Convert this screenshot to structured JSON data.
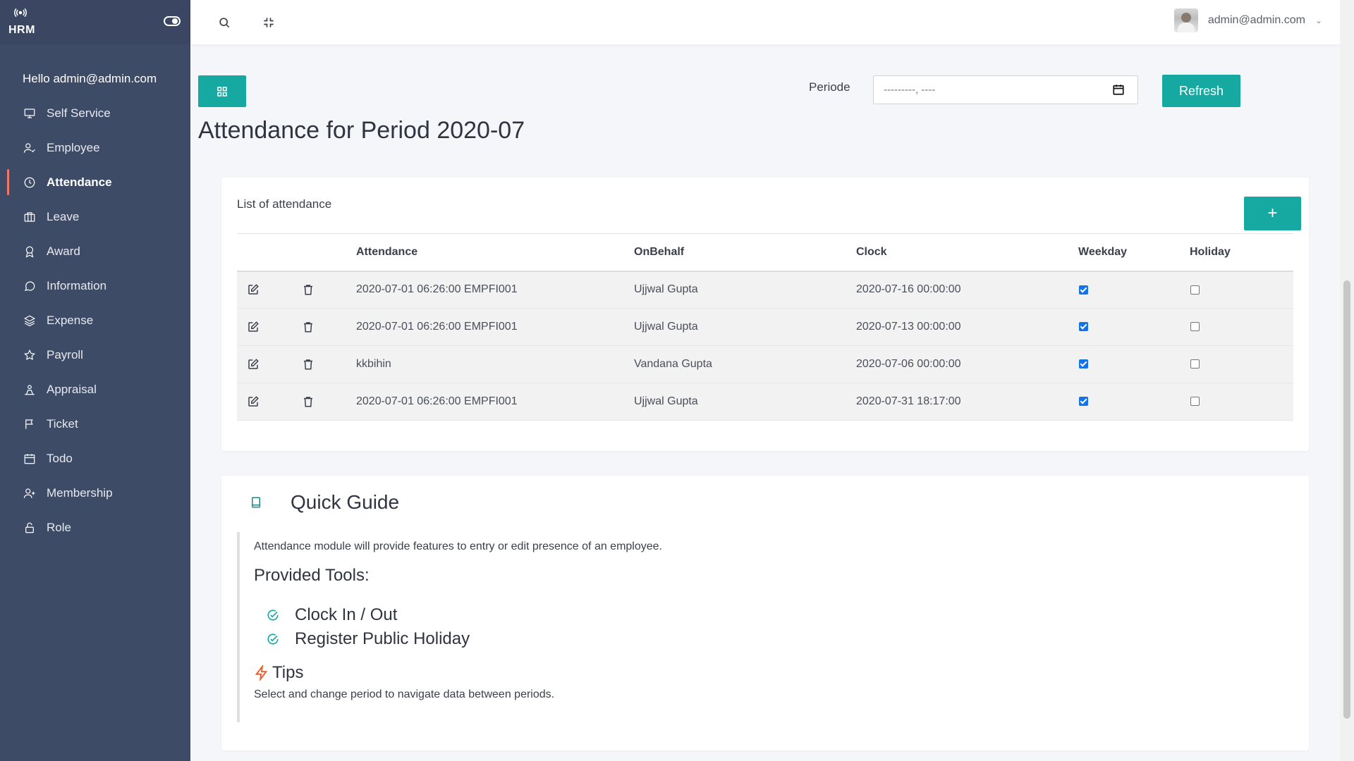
{
  "brand": {
    "name": "HRM",
    "logo_icon": "broadcast-icon",
    "toggle_icon": "toggle-icon"
  },
  "sidebar": {
    "greeting": "Hello admin@admin.com",
    "items": [
      {
        "label": "Self Service",
        "icon": "monitor-icon",
        "active": false
      },
      {
        "label": "Employee",
        "icon": "user-check-icon",
        "active": false
      },
      {
        "label": "Attendance",
        "icon": "clock-icon",
        "active": true
      },
      {
        "label": "Leave",
        "icon": "briefcase-icon",
        "active": false
      },
      {
        "label": "Award",
        "icon": "award-icon",
        "active": false
      },
      {
        "label": "Information",
        "icon": "chat-icon",
        "active": false
      },
      {
        "label": "Expense",
        "icon": "layers-icon",
        "active": false
      },
      {
        "label": "Payroll",
        "icon": "star-icon",
        "active": false
      },
      {
        "label": "Appraisal",
        "icon": "appraisal-icon",
        "active": false
      },
      {
        "label": "Ticket",
        "icon": "flag-icon",
        "active": false
      },
      {
        "label": "Todo",
        "icon": "calendar-icon",
        "active": false
      },
      {
        "label": "Membership",
        "icon": "user-plus-icon",
        "active": false
      },
      {
        "label": "Role",
        "icon": "lock-icon",
        "active": false
      }
    ]
  },
  "topbar": {
    "search_icon": "search-icon",
    "fullscreen_icon": "minimize-icon",
    "user_email": "admin@admin.com"
  },
  "toolbar": {
    "periode_label": "Periode",
    "periode_placeholder": "---------, ----",
    "refresh_label": "Refresh"
  },
  "page": {
    "title": "Attendance for Period 2020-07"
  },
  "list": {
    "title": "List of attendance",
    "add_label": "+",
    "columns": [
      "Attendance",
      "OnBehalf",
      "Clock",
      "Weekday",
      "Holiday"
    ],
    "rows": [
      {
        "attendance": "2020-07-01 06:26:00 EMPFI001",
        "onbehalf": "Ujjwal Gupta",
        "clock": "2020-07-16 00:00:00",
        "weekday": true,
        "holiday": false
      },
      {
        "attendance": "2020-07-01 06:26:00 EMPFI001",
        "onbehalf": "Ujjwal Gupta",
        "clock": "2020-07-13 00:00:00",
        "weekday": true,
        "holiday": false
      },
      {
        "attendance": "kkbihin",
        "onbehalf": "Vandana Gupta",
        "clock": "2020-07-06 00:00:00",
        "weekday": true,
        "holiday": false
      },
      {
        "attendance": "2020-07-01 06:26:00 EMPFI001",
        "onbehalf": "Ujjwal Gupta",
        "clock": "2020-07-31 18:17:00",
        "weekday": true,
        "holiday": false
      }
    ]
  },
  "guide": {
    "title": "Quick Guide",
    "description": "Attendance module will provide features to entry or edit presence of an employee.",
    "tools_heading": "Provided Tools:",
    "tools": [
      "Clock In / Out",
      "Register Public Holiday"
    ],
    "tips_heading": "Tips",
    "tips_text": "Select and change period to navigate data between periods."
  },
  "colors": {
    "sidebar_bg": "#3e4b67",
    "accent": "#16a9a2",
    "active_marker": "#f07a6a",
    "tips_icon": "#f05a28"
  }
}
